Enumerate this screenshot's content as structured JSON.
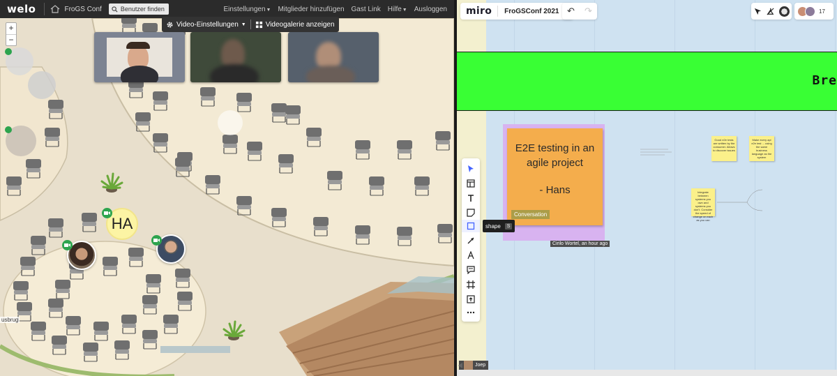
{
  "welo": {
    "logo": "welo",
    "conference_name": "FroGS Conf",
    "find_user": "Benutzer finden",
    "nav": [
      {
        "label": "Einstellungen",
        "dropdown": true
      },
      {
        "label": "Mitglieder hinzufügen",
        "dropdown": false
      },
      {
        "label": "Gast Link",
        "dropdown": false
      },
      {
        "label": "Hilfe",
        "dropdown": true
      },
      {
        "label": "Ausloggen",
        "dropdown": false
      }
    ],
    "zoom_in": "+",
    "zoom_out": "−",
    "video_settings": "Video-Einstellungen",
    "video_gallery": "Videogalerie anzeigen",
    "ha_initials": "HA",
    "floor_label": "usbrug"
  },
  "miro": {
    "logo": "miro",
    "board_name": "FroGSConf 2021",
    "user_count": "17",
    "banner_text": "Bre",
    "sticky_title": "E2E testing in an agile project",
    "sticky_author": "- Hans",
    "sticky_tag": "Conversation",
    "cursor_label": "Cirilo Wortel, an hour ago",
    "tooltip_label": "shape",
    "tooltip_key": "S",
    "user_chip": "Joep",
    "mini_stickies": [
      "Good e2e tests are written by the consumer. Allows to discover issues",
      "Make every api e2e test ... using the same business language as the system",
      "Integrate between systems you own and systems you don't. Consider the speed of change on each as you can"
    ],
    "colors": {
      "banner": "#39ff34",
      "sticky_main": "#f4ad4c",
      "frame": "#d8b3f0",
      "mini_sticky": "#fbf08a"
    }
  }
}
